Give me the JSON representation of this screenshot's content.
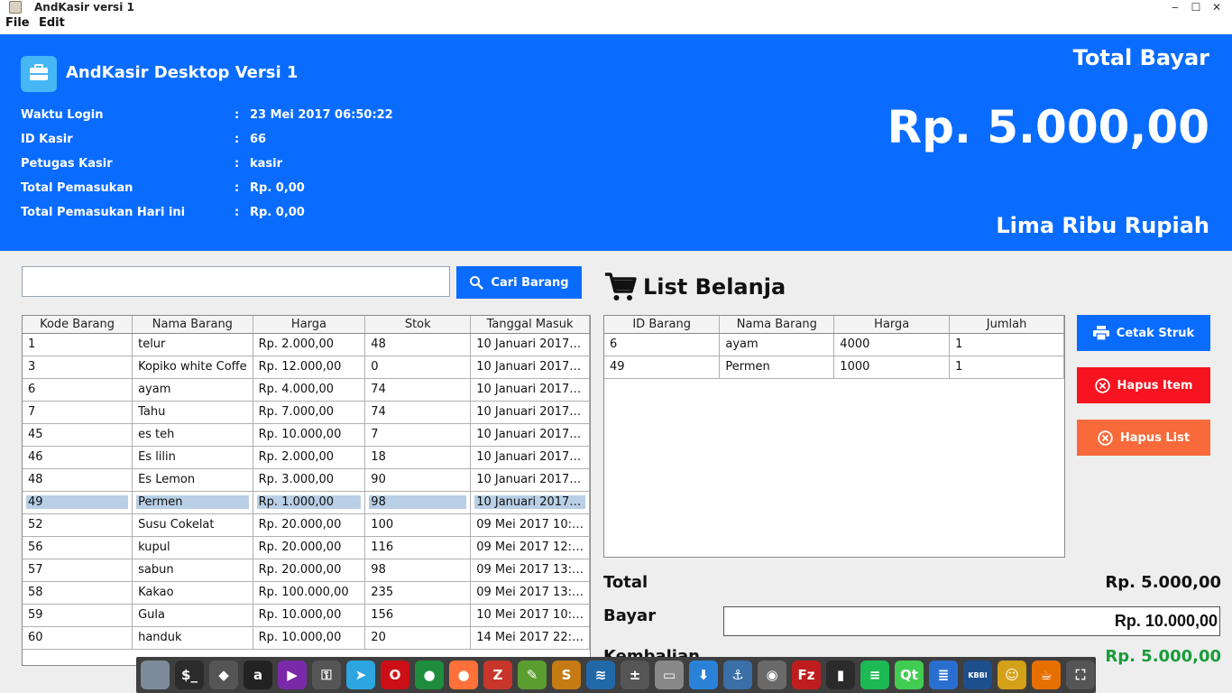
{
  "window": {
    "title": "AndKasir versi 1",
    "minimize": "‒",
    "maximize": "☐",
    "close": "✕"
  },
  "menubar": {
    "file": "File",
    "edit": "Edit"
  },
  "header": {
    "brand_title": "AndKasir Desktop Versi 1",
    "info": [
      {
        "label": "Waktu Login",
        "colon": ":",
        "value": "23 Mei 2017 06:50:22"
      },
      {
        "label": "ID Kasir",
        "colon": ":",
        "value": "66"
      },
      {
        "label": "Petugas Kasir",
        "colon": ":",
        "value": "kasir"
      },
      {
        "label": "Total Pemasukan",
        "colon": ":",
        "value": "Rp. 0,00"
      },
      {
        "label": "Total Pemasukan Hari ini",
        "colon": ":",
        "value": "Rp. 0,00"
      }
    ],
    "total_label": "Total Bayar",
    "total_amount": "Rp. 5.000,00",
    "total_words": "Lima Ribu Rupiah"
  },
  "search": {
    "value": "",
    "placeholder": "",
    "button_label": "Cari Barang"
  },
  "products": {
    "columns": [
      "Kode Barang",
      "Nama Barang",
      "Harga",
      "Stok",
      "Tanggal Masuk"
    ],
    "rows": [
      [
        "1",
        "telur",
        "Rp. 2.000,00",
        "48",
        "10 Januari 2017…"
      ],
      [
        "3",
        "Kopiko white Coffe",
        "Rp. 12.000,00",
        "0",
        "10 Januari 2017…"
      ],
      [
        "6",
        "ayam",
        "Rp. 4.000,00",
        "74",
        "10 Januari 2017…"
      ],
      [
        "7",
        "Tahu",
        "Rp. 7.000,00",
        "74",
        "10 Januari 2017…"
      ],
      [
        "45",
        "es teh",
        "Rp. 10.000,00",
        "7",
        "10 Januari 2017…"
      ],
      [
        "46",
        "Es lilin",
        "Rp. 2.000,00",
        "18",
        "10 Januari 2017…"
      ],
      [
        "48",
        "Es Lemon",
        "Rp. 3.000,00",
        "90",
        "10 Januari 2017…"
      ],
      [
        "49",
        "Permen",
        "Rp. 1.000,00",
        "98",
        "10 Januari 2017…"
      ],
      [
        "52",
        "Susu Cokelat",
        "Rp. 20.000,00",
        "100",
        "09 Mei 2017 10:…"
      ],
      [
        "56",
        "kupul",
        "Rp. 20.000,00",
        "116",
        "09 Mei 2017 12:…"
      ],
      [
        "57",
        "sabun",
        "Rp. 20.000,00",
        "98",
        "09 Mei 2017 13:…"
      ],
      [
        "58",
        "Kakao",
        "Rp. 100.000,00",
        "235",
        "09 Mei 2017 13:…"
      ],
      [
        "59",
        "Gula",
        "Rp. 10.000,00",
        "156",
        "10 Mei 2017 10:…"
      ],
      [
        "60",
        "handuk",
        "Rp. 10.000,00",
        "20",
        "14 Mei 2017 22:…"
      ]
    ],
    "selected_row": 7
  },
  "cart": {
    "title": "List Belanja",
    "columns": [
      "ID Barang",
      "Nama Barang",
      "Harga",
      "Jumlah"
    ],
    "rows": [
      [
        "6",
        "ayam",
        "4000",
        "1"
      ],
      [
        "49",
        "Permen",
        "1000",
        "1"
      ]
    ]
  },
  "actions": {
    "print_label": "Cetak Struk",
    "delete_item_label": "Hapus Item",
    "delete_list_label": "Hapus List"
  },
  "summary": {
    "total_label": "Total",
    "total_value": "Rp. 5.000,00",
    "bayar_label": "Bayar",
    "bayar_value": "Rp. 10.000,00",
    "kembalian_label": "Kembalian",
    "kembalian_value": "Rp. 5.000,00"
  },
  "colors": {
    "primary_blue": "#0a6cff",
    "danger_red": "#f7131f",
    "warning_orange": "#f86a3a",
    "success_green": "#1a9c3a",
    "selection": "#b8cfe5"
  },
  "dock": [
    {
      "name": "files-icon",
      "glyph": "",
      "color": "#7d8a99"
    },
    {
      "name": "terminal-icon",
      "glyph": "$_",
      "color": "#2b2b2b"
    },
    {
      "name": "inkscape-icon",
      "glyph": "◆",
      "color": "#555"
    },
    {
      "name": "amazon-icon",
      "glyph": "a",
      "color": "#222"
    },
    {
      "name": "video-icon",
      "glyph": "▶",
      "color": "#7a2aa8"
    },
    {
      "name": "keys-icon",
      "glyph": "⚿",
      "color": "#555"
    },
    {
      "name": "telegram-icon",
      "glyph": "➤",
      "color": "#2ca5e0"
    },
    {
      "name": "opera-icon",
      "glyph": "O",
      "color": "#cc0f16"
    },
    {
      "name": "chrome-icon",
      "glyph": "●",
      "color": "#1e8e3e"
    },
    {
      "name": "firefox-icon",
      "glyph": "●",
      "color": "#ff7139"
    },
    {
      "name": "filezilla-z-icon",
      "glyph": "Z",
      "color": "#c8352b"
    },
    {
      "name": "leafpad-icon",
      "glyph": "✎",
      "color": "#5a9e2f"
    },
    {
      "name": "sublime-icon",
      "glyph": "S",
      "color": "#c57a14"
    },
    {
      "name": "monitor-icon",
      "glyph": "≋",
      "color": "#2168a8"
    },
    {
      "name": "calculator-icon",
      "glyph": "±",
      "color": "#555"
    },
    {
      "name": "document-viewer-icon",
      "glyph": "▭",
      "color": "#888"
    },
    {
      "name": "download-icon",
      "glyph": "⬇",
      "color": "#2a82d8"
    },
    {
      "name": "screenshot-icon",
      "glyph": "⚓",
      "color": "#3a6fa8"
    },
    {
      "name": "image-viewer-icon",
      "glyph": "◉",
      "color": "#6a6a6a"
    },
    {
      "name": "filezilla-icon",
      "glyph": "Fz",
      "color": "#bf1d1d"
    },
    {
      "name": "notes-icon",
      "glyph": "▮",
      "color": "#2b2b2b"
    },
    {
      "name": "spotify-icon",
      "glyph": "≡",
      "color": "#1db954"
    },
    {
      "name": "qt-icon",
      "glyph": "Qt",
      "color": "#41cd52"
    },
    {
      "name": "writer-icon",
      "glyph": "≣",
      "color": "#2a6fd0"
    },
    {
      "name": "kbbi-icon",
      "glyph": "KBBI",
      "color": "#1d4f8c"
    },
    {
      "name": "avatar-icon",
      "glyph": "☺",
      "color": "#d4a017"
    },
    {
      "name": "java-icon",
      "glyph": "☕",
      "color": "#e76f00"
    },
    {
      "name": "fullscreen-icon",
      "glyph": "⛶",
      "color": "#555"
    }
  ]
}
